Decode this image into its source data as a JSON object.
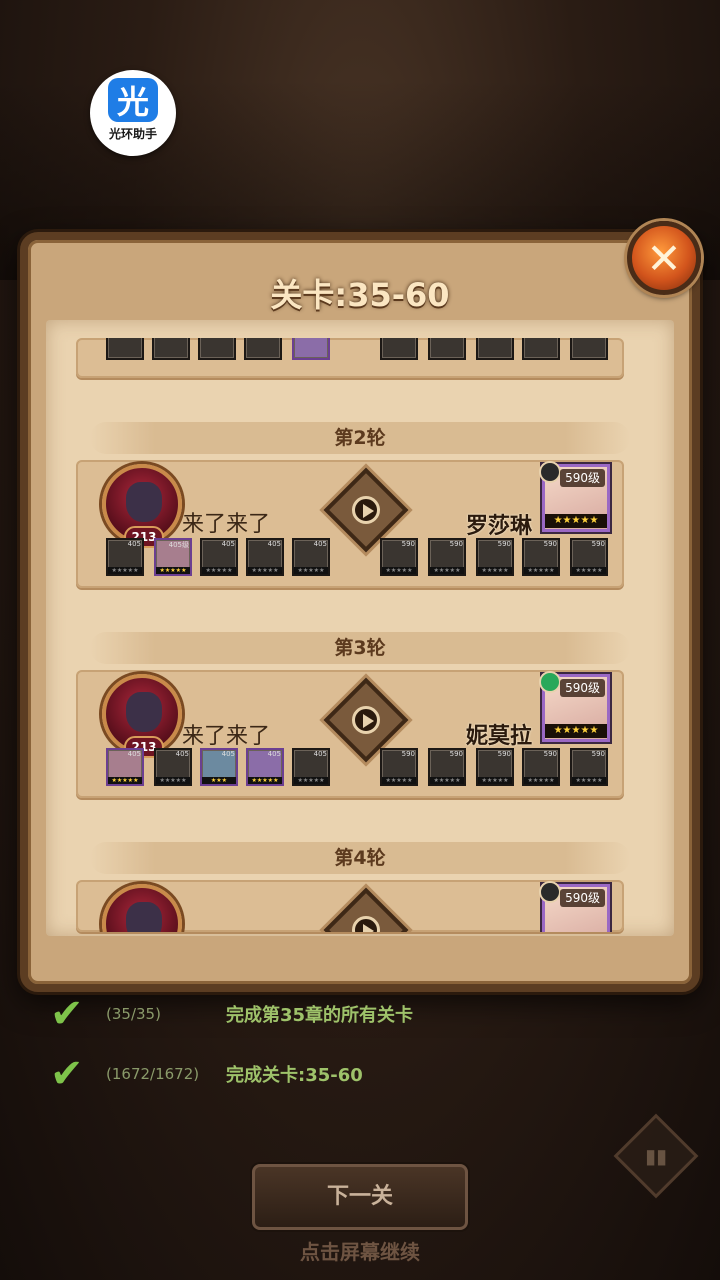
{
  "helper": {
    "glyph": "光",
    "name": "光环助手"
  },
  "panel": {
    "title": "关卡:35-60",
    "close_icon": "✕"
  },
  "rounds": [
    {
      "header": "第2轮",
      "left": {
        "boss_level": "213",
        "team_name": "来了来了",
        "units": [
          {
            "level": "405",
            "stars": "★★★★★",
            "colored": false
          },
          {
            "level": "405级",
            "stars": "★★★★★",
            "colored": true
          },
          {
            "level": "405",
            "stars": "★★★★★",
            "colored": false
          },
          {
            "level": "405",
            "stars": "★★★★★",
            "colored": false
          },
          {
            "level": "405",
            "stars": "★★★★★",
            "colored": false
          }
        ]
      },
      "right": {
        "hero_level": "590级",
        "hero_stars": "★★★★★",
        "name": "罗莎琳",
        "units": [
          {
            "level": "590",
            "stars": "★★★★★"
          },
          {
            "level": "590",
            "stars": "★★★★★"
          },
          {
            "level": "590",
            "stars": "★★★★★"
          },
          {
            "level": "590",
            "stars": "★★★★★"
          },
          {
            "level": "590",
            "stars": "★★★★★"
          }
        ]
      }
    },
    {
      "header": "第3轮",
      "left": {
        "boss_level": "213",
        "team_name": "来了来了",
        "units": [
          {
            "level": "405",
            "stars": "★★★★★",
            "colored": true
          },
          {
            "level": "405",
            "stars": "★★★★★",
            "colored": false
          },
          {
            "level": "405",
            "stars": "★★★",
            "colored": true
          },
          {
            "level": "405",
            "stars": "★★★★★",
            "colored": true
          },
          {
            "level": "405",
            "stars": "★★★★★",
            "colored": false
          }
        ]
      },
      "right": {
        "hero_level": "590级",
        "hero_stars": "★★★★★",
        "name": "妮莫拉",
        "units": [
          {
            "level": "590",
            "stars": "★★★★★"
          },
          {
            "level": "590",
            "stars": "★★★★★"
          },
          {
            "level": "590",
            "stars": "★★★★★"
          },
          {
            "level": "590",
            "stars": "★★★★★"
          },
          {
            "level": "590",
            "stars": "★★★★★"
          }
        ]
      }
    },
    {
      "header": "第4轮",
      "right": {
        "hero_level": "590级"
      }
    }
  ],
  "achievements": [
    {
      "progress": "(35/35)",
      "text": "完成第35章的所有关卡"
    },
    {
      "progress": "(1672/1672)",
      "text": "完成关卡:35-60"
    }
  ],
  "next_button": "下一关",
  "tap_continue": "点击屏幕继续",
  "colors": {
    "check": "#7ec34a",
    "panel_bg": "#ead3b0",
    "title": "#fbe6c2"
  }
}
